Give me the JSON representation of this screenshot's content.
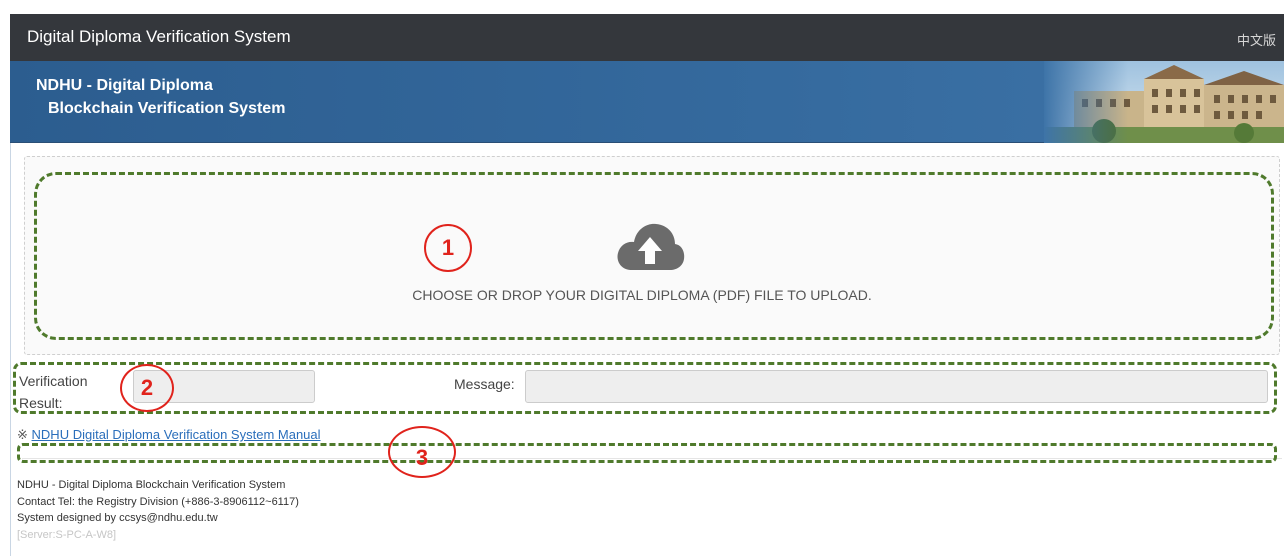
{
  "header": {
    "title": "Digital Diploma Verification System",
    "language_link": "中文版"
  },
  "banner": {
    "line1": "NDHU - Digital Diploma",
    "line2": "Blockchain Verification System"
  },
  "upload": {
    "icon": "cloud-upload-icon",
    "instruction": "CHOOSE OR DROP YOUR DIGITAL DIPLOMA (PDF) FILE TO UPLOAD."
  },
  "verification": {
    "result_label_line1": "Verification",
    "result_label_line2": "Result:",
    "result_value": "",
    "message_label": "Message:",
    "message_value": ""
  },
  "manual": {
    "mark": "※",
    "link_text": "NDHU Digital Diploma Verification System Manual"
  },
  "annotations": {
    "marker1": "1",
    "marker2": "2",
    "marker3": "3",
    "dash_color": "#4f7a2c",
    "circle_color": "#e0231c"
  },
  "footer": {
    "line1": "NDHU - Digital Diploma Blockchain Verification System",
    "line2": "Contact Tel: the Registry Division (+886-3-8906112~6117)",
    "line3": "System designed by ccsys@ndhu.edu.tw",
    "server": "[Server:S-PC-A-W8]"
  },
  "colors": {
    "topbar": "#34373c",
    "banner": "#356a9e",
    "link": "#2a6ebb"
  }
}
